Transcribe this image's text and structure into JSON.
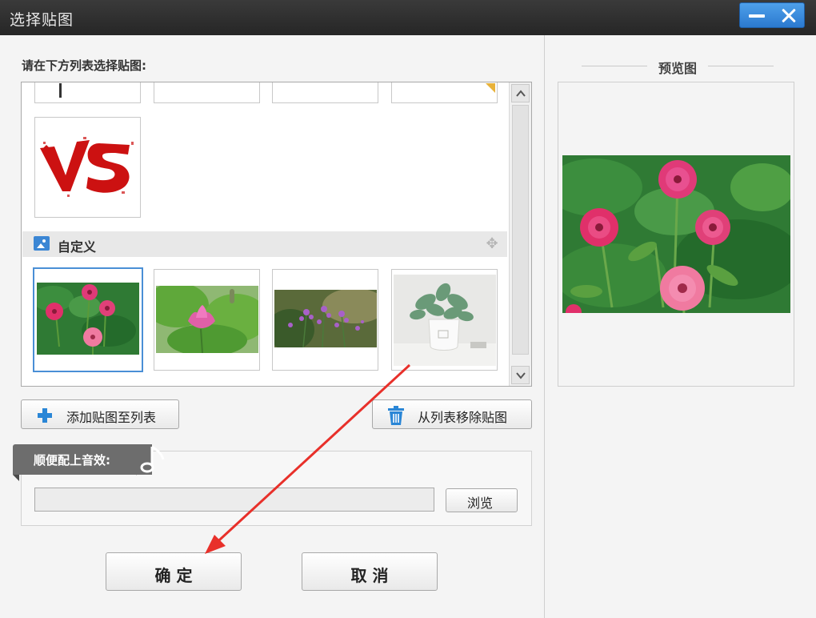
{
  "window": {
    "title": "选择贴图"
  },
  "list": {
    "instruction": "请在下方列表选择贴图:",
    "category_label": "自定义",
    "upper_items": [
      {
        "icon": "partial-sticker"
      },
      {
        "icon": "partial-sticker"
      },
      {
        "icon": "partial-sticker"
      },
      {
        "icon": "partial-sticker-corner"
      }
    ],
    "vs_sticker_icon": "vs-sticker",
    "custom_items": [
      {
        "icon": "zinnia-flowers-photo",
        "selected": true
      },
      {
        "icon": "lotus-flower-photo",
        "selected": false
      },
      {
        "icon": "purple-flowers-photo",
        "selected": false
      },
      {
        "icon": "potted-plant-photo",
        "selected": false
      }
    ]
  },
  "actions": {
    "add_to_list": "添加贴图至列表",
    "remove_from_list": "从列表移除贴图"
  },
  "sound": {
    "label": "顺便配上音效:",
    "path_value": "",
    "browse": "浏览"
  },
  "dialog": {
    "ok": "确 定",
    "cancel": "取 消"
  },
  "preview": {
    "title": "预览图"
  },
  "colors": {
    "accent": "#3b86d4",
    "selection": "#4a8fd6",
    "annotation_arrow": "#e8302a"
  }
}
